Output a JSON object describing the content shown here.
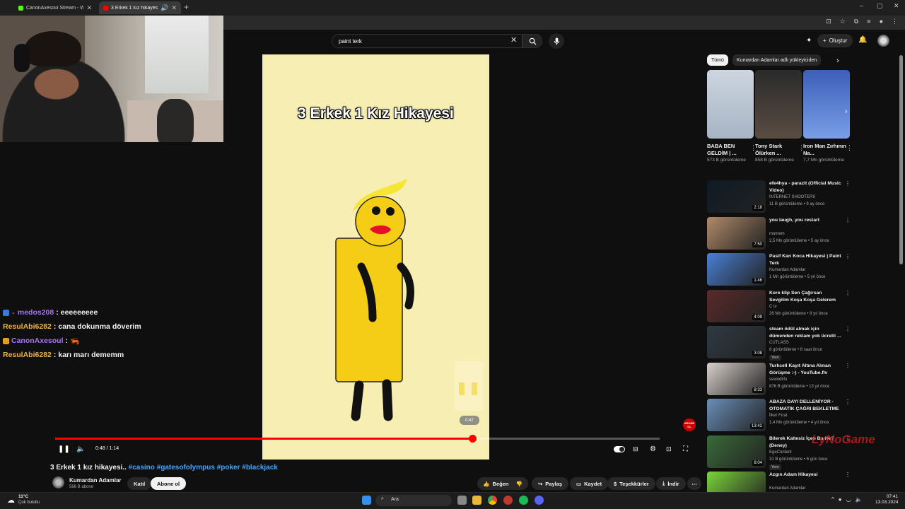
{
  "browser": {
    "tabs": [
      {
        "title": "CanonAxesoul Stream - Watch",
        "favicon_color": "#53fc18"
      },
      {
        "title": "3 Erkek 1 kız hikayesi.. #ca",
        "favicon_color": "#ff0000"
      }
    ],
    "new_tab": "+",
    "window_controls": [
      "–",
      "▢",
      "✕"
    ]
  },
  "youtube": {
    "search_value": "paint terk",
    "create_label": "Oluştur",
    "chips": [
      "Tümü",
      "Kumardan Adamlar adlı yükleyiciden"
    ],
    "video": {
      "overlay_title": "3 Erkek 1 Kız Hikayesi",
      "time": "0:48 / 1:14",
      "progress": 0.69,
      "scrub_preview": "0:47",
      "watermark_subscribe": "ABONE OL"
    },
    "title_plain": "3 Erkek 1 kız hikayesi.. ",
    "title_tags": "#casino #gatesofolympus #poker #blackjack",
    "channel": {
      "name": "Kumardan Adamlar",
      "subs": "566 B abone"
    },
    "join_label": "Katıl",
    "subscribe_label": "Abone ol",
    "actions": {
      "like": "Beğen",
      "share": "Paylaş",
      "save": "Kaydet",
      "thanks": "Teşekkürler",
      "download": "İndir"
    },
    "shorts": [
      {
        "title": "BABA BEN GELDİM | ...",
        "views": "573 B görüntüleme",
        "color": "#c9d1da"
      },
      {
        "title": "Tony Stark Ölürken ...",
        "views": "858 B görüntüleme",
        "color": "#3a3330"
      },
      {
        "title": "Iron Man Zırhının Na...",
        "views": "7,7 Mn görüntüleme",
        "color": "#5a6fb0"
      }
    ],
    "recommendations": [
      {
        "title": "efe4hya - parazit (Official Music Video)",
        "channel": "INTERNET SHOOTERS",
        "meta": "11 B görüntüleme • 9 ay önce",
        "duration": "2:18",
        "color": "#0e1a24",
        "new": ""
      },
      {
        "title": "you laugh, you restart",
        "channel": "momem",
        "meta": "2,5 Mn görüntüleme • 5 ay önce",
        "duration": "7:50",
        "color": "#b08a6a",
        "new": ""
      },
      {
        "title": "Pasif Karı Koca Hikayesi | Paint Terk",
        "channel": "Kumardan Adamlar",
        "meta": "1 Mn görüntüleme • 5 yıl önce",
        "duration": "1:46",
        "color": "#4a7fd4",
        "new": ""
      },
      {
        "title": "Kore klip Sen Çağırsan Sevgilim Koşa Koşa Gelerem",
        "channel": "C tv",
        "meta": "26 Mn görüntüleme • 8 yıl önce",
        "duration": "4:09",
        "color": "#5a2a2a",
        "new": ""
      },
      {
        "title": "steam ödül almak için dümenden reklam yok ücretli ...",
        "channel": "CUTLASS",
        "meta": "8 görüntüleme • 8 saat önce",
        "duration": "3:08",
        "color": "#2f3a44",
        "new": "Yeni"
      },
      {
        "title": "Turkcell Kayıt Altına Alınan Görüşme :-) - YouTube.flv",
        "channel": "seviodkfu",
        "meta": "876 B görüntüleme • 13 yıl önce",
        "duration": "8:33",
        "color": "#d8d0cc",
        "new": ""
      },
      {
        "title": "ABAZA DAYI DELLENİYOR - OTOMATİK ÇAĞRI BEKLETME ...",
        "channel": "İlker Fırat",
        "meta": "1,4 Mn görüntüleme • 4 yıl önce",
        "duration": "13:42",
        "color": "#6a8fb8",
        "new": ""
      },
      {
        "title": "Bilerek Kaltesiz İçen Bu Ne? (Deney)",
        "channel": "EgeContent",
        "meta": "31 B görüntüleme • 6 gün önce",
        "duration": "8:04",
        "color": "#3a6a3a",
        "new": "Yeni"
      },
      {
        "title": "Azgın Adam Hikayesi",
        "channel": "Kumardan Adamlar",
        "meta": "2,1 Mn görüntüleme • 6 yıl önce",
        "duration": "",
        "color": "#7ad43a",
        "new": ""
      }
    ]
  },
  "chat": [
    {
      "user": "medos208",
      "user_color": "#a970ff",
      "message": "eeeeeeeee",
      "badge": "#3a7bd5"
    },
    {
      "user": "ResulAbi6282",
      "user_color": "#f0b040",
      "message": "cana dokunma döverim",
      "badge": ""
    },
    {
      "user": "CanonAxesoul",
      "user_color": "#a970ff",
      "message": "🦐",
      "badge": "#e0a020"
    },
    {
      "user": "ResulAbi6282",
      "user_color": "#f0b040",
      "message": "karı marı dememm",
      "badge": ""
    }
  ],
  "stream_watermark": "LyNoGame",
  "taskbar": {
    "temp": "11°C",
    "weather": "Çok bulutlu",
    "search": "Ara",
    "time": "07:41",
    "date": "13.03.2024"
  }
}
